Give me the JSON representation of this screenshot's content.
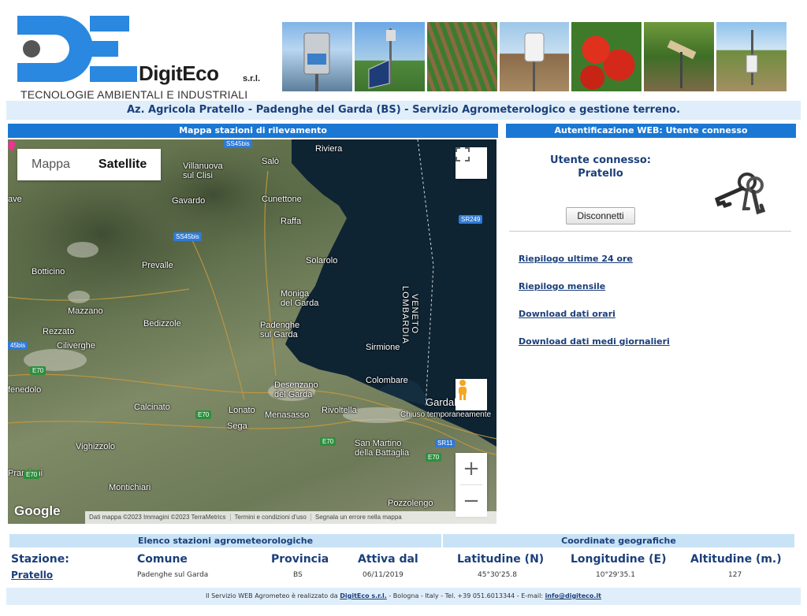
{
  "header": {
    "logo_name": "DigitEco",
    "logo_suffix": "s.r.l.",
    "logo_tagline": "TECNOLOGIE AMBIENTALI E INDUSTRIALI",
    "subtitle": "Az. Agricola Pratello - Padenghe del Garda (BS) - Servizio Agrometerologico e gestione terreno."
  },
  "map_panel": {
    "title": "Mappa stazioni di rilevamento",
    "maptype_map": "Mappa",
    "maptype_satellite": "Satellite",
    "google": "Google",
    "attribution": [
      "Dati mappa ©2023 Immagini ©2023 TerraMetrics",
      "Termini e condizioni d'uso",
      "Segnala un errore nella mappa"
    ],
    "places": {
      "riviera": "Riviera",
      "salo": "Salò",
      "villanuova": "Villanuova\nsul Clisi",
      "gavardo": "Gavardo",
      "cunettone": "Cunettone",
      "raffa": "Raffa",
      "prevalle": "Prevalle",
      "botticino": "Botticino",
      "solarolo": "Solarolo",
      "moniga": "Moniga\ndel Garda",
      "mazzano": "Mazzano",
      "bedizzole": "Bedizzole",
      "padenghe": "Padenghe\nsul Garda",
      "rezzato": "Rezzato",
      "ciliverghe": "Ciliverghe",
      "sirmione": "Sirmione",
      "fenedolo": "fenedolo",
      "colombare": "Colombare",
      "desenzano": "Desenzano\ndel Garda",
      "calcinato": "Calcinato",
      "lonato": "Lonato",
      "menasasso": "Menasasso",
      "rivoltella": "Rivoltella",
      "gardaland": "Gardaland",
      "chiuso": "Chiuso temporaneamente",
      "sega": "Sega",
      "vighizzolo": "Vighizzolo",
      "sanmartino": "San Martino\ndella Battaglia",
      "prandoni": "Prandoni",
      "montichiari": "Montichiari",
      "pozzolengo": "Pozzolengo",
      "ave": "ave",
      "veneto": "VENETO",
      "lombardia": "LOMBARDIA"
    },
    "roads": {
      "sp45bis_top": "SS45bis",
      "sp45bis_mid": "SS45bis",
      "sp45bis_left": "45bis",
      "sr249": "SR249",
      "e70_a": "E70",
      "e70_b": "E70",
      "e70_c": "E70",
      "e70_d": "E70",
      "e70_e": "E70",
      "sr11": "SR11"
    }
  },
  "auth_panel": {
    "title": "Autentificazione WEB: Utente connesso",
    "user_label": "Utente connesso:",
    "user_name": "Pratello",
    "disconnect": "Disconnetti",
    "links": [
      "Riepilogo ultime 24 ore",
      "Riepilogo mensile",
      "Download dati orari",
      "Download dati medi giornalieri"
    ]
  },
  "stations": {
    "section_left": "Elenco stazioni agrometeorologiche",
    "section_right": "Coordinate geografiche",
    "headers": {
      "station": "Stazione:",
      "comune": "Comune",
      "provincia": "Provincia",
      "attiva": "Attiva dal",
      "lat": "Latitudine (N)",
      "lon": "Longitudine (E)",
      "alt": "Altitudine (m.)"
    },
    "row": {
      "station": "Pratello",
      "comune": "Padenghe sul Garda",
      "provincia": "BS",
      "attiva": "06/11/2019",
      "lat": "45°30'25.8",
      "lon": "10°29'35.1",
      "alt": "127"
    }
  },
  "footer": {
    "prefix": "Il Servizio WEB Agrometeo è realizzato da",
    "company": "DigitEco s.r.l.",
    "middle": "- Bologna - Italy - Tel. +39 051.6013344 - E-mail:",
    "email": "info@digiteco.it"
  },
  "colors": {
    "accent": "#1a78d4",
    "navy": "#1b3f7a",
    "light_bar": "#dfeefa",
    "lake": "#0e2433",
    "marker": "#e8358f"
  },
  "icons": [
    "logo-mark",
    "fullscreen-icon",
    "pegman-icon",
    "zoom-in-icon",
    "zoom-out-icon",
    "location-marker-icon",
    "keys-icon"
  ]
}
